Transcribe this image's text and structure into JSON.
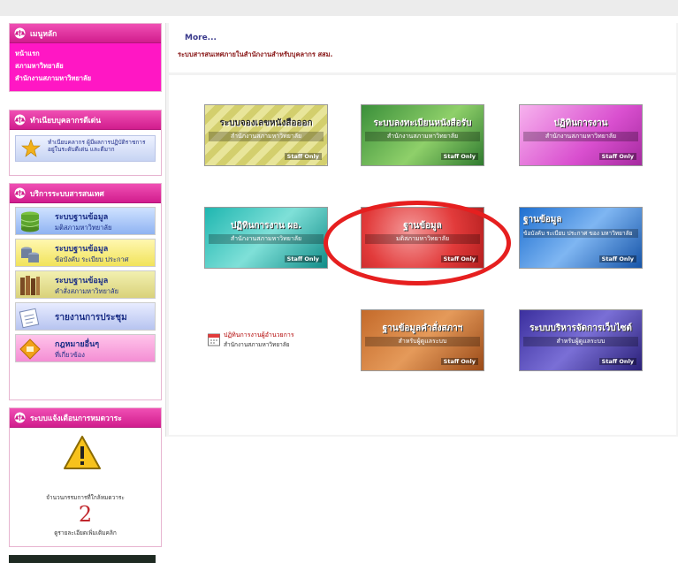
{
  "colors": {
    "accent": "#e23fa9",
    "highlight": "#e61f1f"
  },
  "sidebar": {
    "main_menu": {
      "title": "เมนูหลัก",
      "items": [
        "หน้าแรก",
        "สภามหาวิทยาลัย",
        "สำนักงานสภามหาวิทยาลัย"
      ]
    },
    "personnel": {
      "title": "ทำเนียบบุคลากรดีเด่น",
      "banner_text": "ทำเนียบคลากร ผู้มีผลการปฏิบัติราชการ อยู่ในระดับดีเด่น และดีมาก"
    },
    "services": {
      "title": "บริการระบบสารสนเทศ",
      "items": [
        {
          "line1": "ระบบฐานข้อมูล",
          "line2": "มติสภามหาวิทยาลัย",
          "icon": "database-icon"
        },
        {
          "line1": "ระบบฐานข้อมูล",
          "line2": "ข้อบังคับ ระเบียบ ประกาศ",
          "icon": "database-icon"
        },
        {
          "line1": "ระบบฐานข้อมูล",
          "line2": "คำสั่งสภามหาวิทยาลัย",
          "icon": "books-icon"
        },
        {
          "line1": "รายงานการประชุม",
          "line2": "",
          "icon": "report-icon"
        },
        {
          "line1": "กฎหมายอื่นๆ",
          "line2": "ที่เกี่ยวข้อง",
          "icon": "law-icon"
        }
      ]
    },
    "alert": {
      "title": "ระบบแจ้งเตือนการหมดวาระ",
      "caption": "จำนวนกรรมการที่ใกล้หมดวาระ",
      "count": "2",
      "more": "ดูรายละเอียดเพิ่มเติมคลิก"
    }
  },
  "main": {
    "more_link": "More...",
    "subtitle": "ระบบสารสนเทศภายในสำนักงานสำหรับบุคลากร สสม.",
    "tiles": [
      {
        "title": "ระบบจองเลขหนังสือออก",
        "subtitle": "สำนักงานสภามหาวิทยาลัย",
        "badge": "Staff Only"
      },
      {
        "title": "ระบบลงทะเบียนหนังสือรับ",
        "subtitle": "สำนักงานสภามหาวิทยาลัย",
        "badge": "Staff Only"
      },
      {
        "title": "ปฏิทินการงาน",
        "subtitle": "สำนักงานสภามหาวิทยาลัย",
        "badge": "Staff Only"
      },
      {
        "title": "ปฏิทินการงาน ผอ.",
        "subtitle": "สำนักงานสภามหาวิทยาลัย",
        "badge": "Staff Only"
      },
      {
        "title": "ฐานข้อมูล",
        "subtitle": "มติสภามหาวิทยาลัย",
        "badge": "Staff Only"
      },
      {
        "title": "ฐานข้อมูล",
        "subtitle": "ข้อบังคับ ระเบียบ ประกาศ ของ มหาวิทยาลัย",
        "badge": "Staff Only"
      },
      {
        "title": "ปฏิทินการงานผู้อำนวยการ",
        "subtitle": "สำนักงานสภามหาวิทยาลัย",
        "badge": ""
      },
      {
        "title": "ฐานข้อมูลคำสั่งสภาฯ",
        "subtitle": "สำหรับผู้ดูแลระบบ",
        "badge": "Staff Only"
      },
      {
        "title": "ระบบบริหารจัดการเว็บไซต์",
        "subtitle": "สำหรับผู้ดูแลระบบ",
        "badge": "Staff Only"
      }
    ]
  }
}
